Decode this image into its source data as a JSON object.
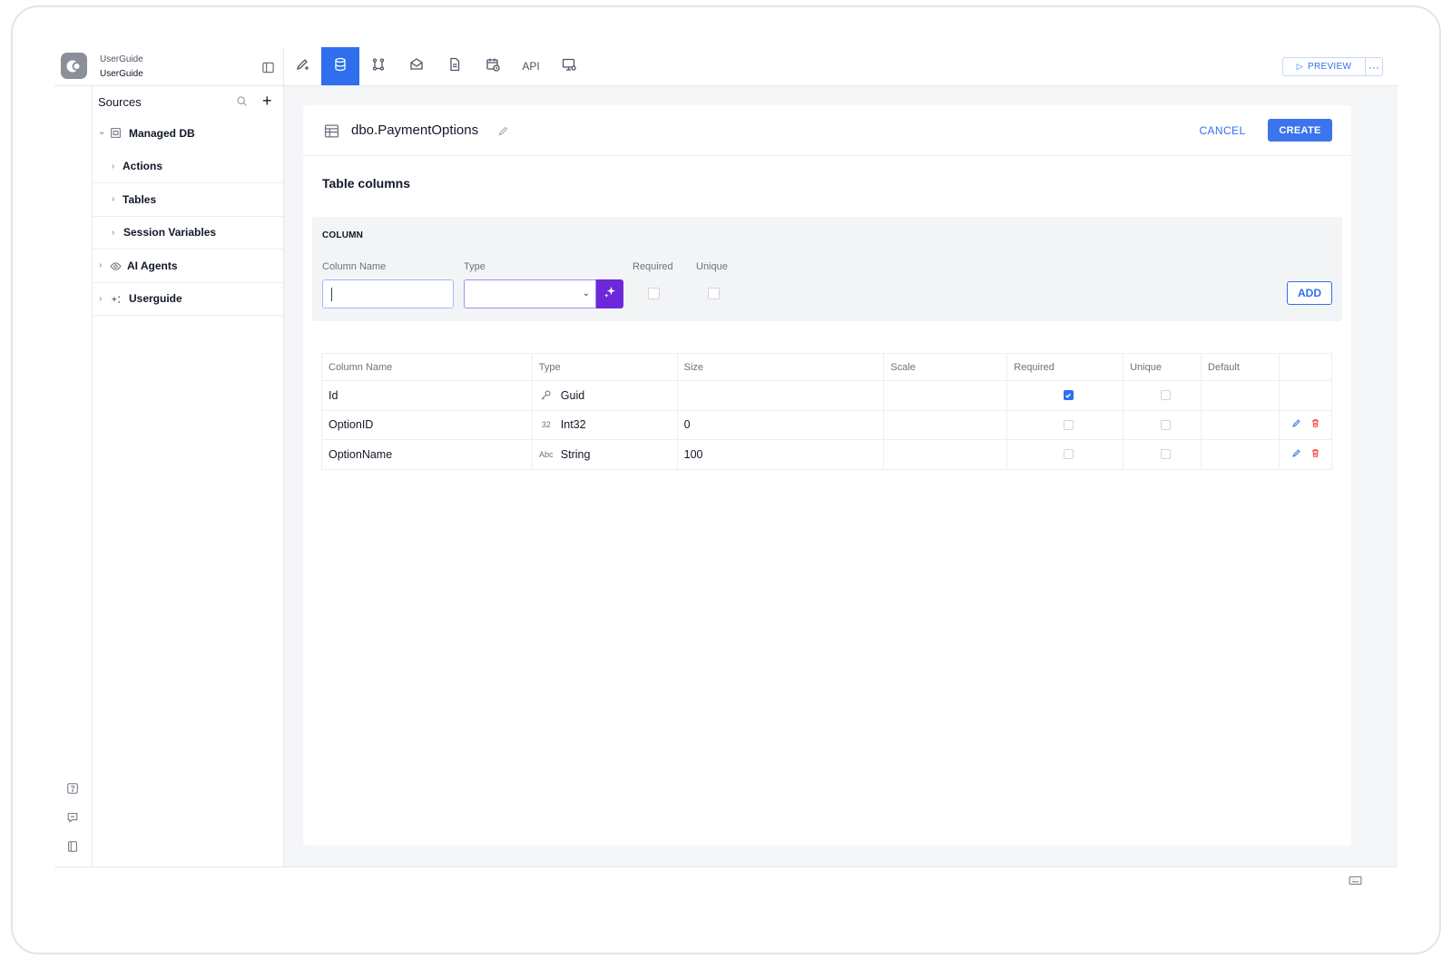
{
  "app": {
    "org": "UserGuide",
    "project": "UserGuide"
  },
  "topbar": {
    "tabs": [
      {
        "icon": "pencil-plus-icon"
      },
      {
        "icon": "database-icon",
        "active": true
      },
      {
        "icon": "workflow-icon"
      },
      {
        "icon": "mail-icon"
      },
      {
        "icon": "document-icon"
      },
      {
        "icon": "calendar-clock-icon"
      },
      {
        "label": "API"
      },
      {
        "icon": "monitor-settings-icon"
      }
    ],
    "preview_label": "PREVIEW",
    "more_label": "···"
  },
  "sidebar": {
    "title": "Sources",
    "items": [
      {
        "label": "Managed DB",
        "expanded": true,
        "icon": "database-box-icon"
      },
      {
        "label": "Actions",
        "child": true
      },
      {
        "label": "Tables",
        "child": true
      },
      {
        "label": "Session Variables",
        "child": true
      },
      {
        "label": "AI Agents",
        "icon": "eye-icon"
      },
      {
        "label": "Userguide",
        "icon": "sparkle-nodes-icon"
      }
    ]
  },
  "editor": {
    "table_name": "dbo.PaymentOptions",
    "cancel_label": "CANCEL",
    "create_label": "CREATE",
    "section_title": "Table columns",
    "new_column": {
      "heading": "COLUMN",
      "column_name_label": "Column Name",
      "column_name_value": "",
      "type_label": "Type",
      "type_value": "",
      "required_label": "Required",
      "unique_label": "Unique",
      "add_label": "ADD"
    },
    "columns_table": {
      "headers": [
        "Column Name",
        "Type",
        "Size",
        "Scale",
        "Required",
        "Unique",
        "Default",
        ""
      ],
      "rows": [
        {
          "name": "Id",
          "type_icon": "key-icon",
          "type": "Guid",
          "size": "",
          "scale": "",
          "required": true,
          "unique": false,
          "default": "",
          "editable": false
        },
        {
          "name": "OptionID",
          "type_icon_text": "32",
          "type": "Int32",
          "size": "0",
          "scale": "",
          "required": false,
          "unique": false,
          "default": "",
          "editable": true
        },
        {
          "name": "OptionName",
          "type_icon_text": "Abc",
          "type": "String",
          "size": "100",
          "scale": "",
          "required": false,
          "unique": false,
          "default": "",
          "editable": true
        }
      ]
    }
  },
  "colors": {
    "accent": "#2f6fed",
    "ai_button": "#6d28d9",
    "danger": "#ef4444"
  }
}
